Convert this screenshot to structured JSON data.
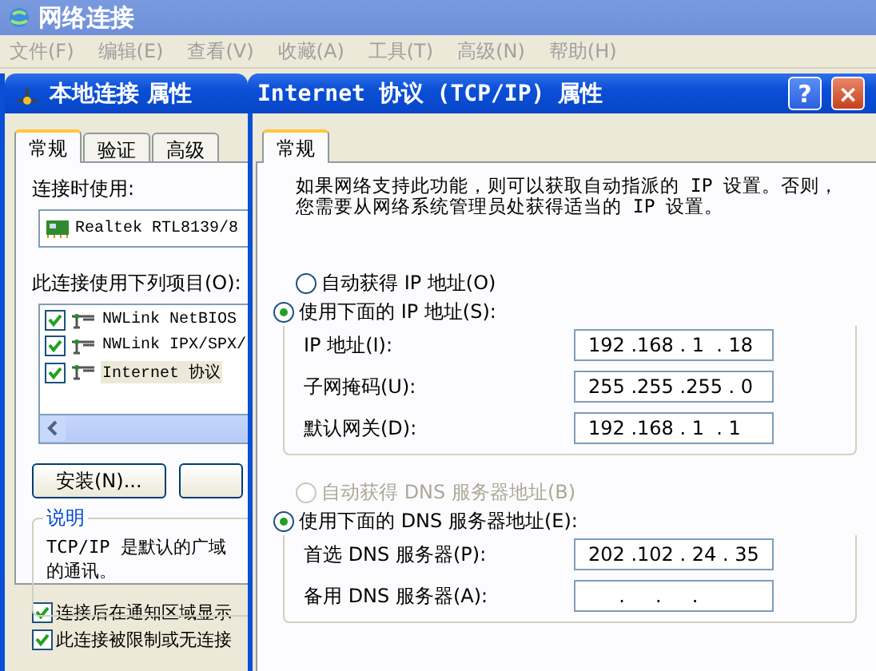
{
  "background_window": {
    "title": "网络连接",
    "menu": [
      "文件(F)",
      "编辑(E)",
      "查看(V)",
      "收藏(A)",
      "工具(T)",
      "高级(N)",
      "帮助(H)"
    ]
  },
  "local_dialog": {
    "title": "本地连接 属性",
    "tabs": [
      {
        "label": "常规",
        "selected": true
      },
      {
        "label": "验证",
        "selected": false
      },
      {
        "label": "高级",
        "selected": false
      }
    ],
    "connect_using_label": "连接时使用:",
    "adapter": "Realtek RTL8139/8",
    "items_label": "此连接使用下列项目(O):",
    "items": [
      {
        "label": "NWLink NetBIOS",
        "checked": true,
        "selected": false
      },
      {
        "label": "NWLink IPX/SPX/",
        "checked": true,
        "selected": false
      },
      {
        "label": "Internet 协议",
        "checked": true,
        "selected": true
      }
    ],
    "install_button": "安装(N)...",
    "description": {
      "title": "说明",
      "lines": [
        "TCP/IP 是默认的广域",
        "的通讯。"
      ]
    },
    "options": [
      {
        "label": "连接后在通知区域显示",
        "checked": true
      },
      {
        "label": "此连接被限制或无连接",
        "checked": true
      }
    ]
  },
  "tcpip_dialog": {
    "title": "Internet 协议 (TCP/IP) 属性",
    "help_button": "?",
    "close_button": "×",
    "tabs": [
      {
        "label": "常规",
        "selected": true
      }
    ],
    "intro_lines": [
      "如果网络支持此功能，则可以获取自动指派的 IP 设置。否则，",
      "您需要从网络系统管理员处获得适当的 IP 设置。"
    ],
    "ip": {
      "auto_option": {
        "label": "自动获得 IP 地址(O)",
        "selected": false,
        "disabled": false
      },
      "manual_option": {
        "label": "使用下面的 IP 地址(S):",
        "selected": true,
        "disabled": false
      },
      "fields": [
        {
          "label": "IP 地址(I):",
          "value": "192 .168 . 1  . 18"
        },
        {
          "label": "子网掩码(U):",
          "value": "255 .255 .255 . 0"
        },
        {
          "label": "默认网关(D):",
          "value": "192 .168 . 1  . 1"
        }
      ]
    },
    "dns": {
      "auto_option": {
        "label": "自动获得 DNS 服务器地址(B)",
        "selected": false,
        "disabled": true
      },
      "manual_option": {
        "label": "使用下面的 DNS 服务器地址(E):",
        "selected": true,
        "disabled": false
      },
      "fields": [
        {
          "label": "首选 DNS 服务器(P):",
          "value": "202 .102 . 24 . 35"
        },
        {
          "label": "备用 DNS 服务器(A):",
          "value": "     .     .     ."
        }
      ]
    }
  }
}
